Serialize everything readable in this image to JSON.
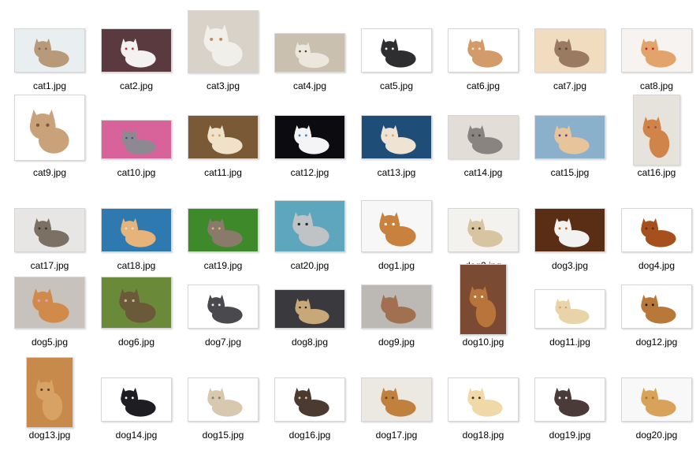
{
  "files": [
    {
      "name": "cat1.jpg",
      "shape": "wide",
      "bg": "#e9eef0",
      "subject": "#b89a7a",
      "accent": "#8a6a4e"
    },
    {
      "name": "cat2.jpg",
      "shape": "wide",
      "bg": "#5a3a3e",
      "subject": "#f4f2f0",
      "accent": "#c8283a"
    },
    {
      "name": "cat3.jpg",
      "shape": "tall4",
      "bg": "#d9d2c8",
      "subject": "#f1efe9",
      "accent": "#c88a54"
    },
    {
      "name": "cat4.jpg",
      "shape": "wide2",
      "bg": "#c9c0b0",
      "subject": "#ece7dc",
      "accent": "#4a3c2a"
    },
    {
      "name": "cat5.jpg",
      "shape": "wide",
      "bg": "#ffffff",
      "subject": "#2e2e30",
      "accent": "#f0f0f0"
    },
    {
      "name": "cat6.jpg",
      "shape": "wide",
      "bg": "#ffffff",
      "subject": "#d39a6a",
      "accent": "#f2e2d0"
    },
    {
      "name": "cat7.jpg",
      "shape": "wide",
      "bg": "#f1dcbf",
      "subject": "#9a7a60",
      "accent": "#5e4634"
    },
    {
      "name": "cat8.jpg",
      "shape": "wide",
      "bg": "#f6f3f0",
      "subject": "#e2a46a",
      "accent": "#c8202e"
    },
    {
      "name": "cat9.jpg",
      "shape": "tall",
      "bg": "#ffffff",
      "subject": "#c9a27a",
      "accent": "#7a5a3e"
    },
    {
      "name": "cat10.jpg",
      "shape": "wide2",
      "bg": "#d8629a",
      "subject": "#8c8a90",
      "accent": "#3e4e8a"
    },
    {
      "name": "cat11.jpg",
      "shape": "wide",
      "bg": "#7a5a36",
      "subject": "#f0e2c8",
      "accent": "#d2a064"
    },
    {
      "name": "cat12.jpg",
      "shape": "wide",
      "bg": "#0c0c10",
      "subject": "#f4f4f6",
      "accent": "#3a8ad0"
    },
    {
      "name": "cat13.jpg",
      "shape": "wide",
      "bg": "#1e4e78",
      "subject": "#efe4d4",
      "accent": "#d2a676"
    },
    {
      "name": "cat14.jpg",
      "shape": "wide",
      "bg": "#e2ddd6",
      "subject": "#8a8480",
      "accent": "#4a4440"
    },
    {
      "name": "cat15.jpg",
      "shape": "wide",
      "bg": "#8ab0cc",
      "subject": "#e8c49a",
      "accent": "#6a3aa0"
    },
    {
      "name": "cat16.jpg",
      "shape": "portrait",
      "bg": "#e6e2dc",
      "subject": "#d0844a",
      "accent": "#a45a2a"
    },
    {
      "name": "cat17.jpg",
      "shape": "wide",
      "bg": "#e8e6e4",
      "subject": "#7a7064",
      "accent": "#3a3430"
    },
    {
      "name": "cat18.jpg",
      "shape": "wide",
      "bg": "#2e7ab0",
      "subject": "#e6b47a",
      "accent": "#cfe0ea"
    },
    {
      "name": "cat19.jpg",
      "shape": "wide",
      "bg": "#3e8a2a",
      "subject": "#8a7a6a",
      "accent": "#d6b488"
    },
    {
      "name": "cat20.jpg",
      "shape": "tall3",
      "bg": "#5ea6be",
      "subject": "#bfc3c6",
      "accent": "#2a2a2a"
    },
    {
      "name": "dog1.jpg",
      "shape": "tall3",
      "bg": "#f7f7f7",
      "subject": "#c9823e",
      "accent": "#ffffff"
    },
    {
      "name": "dog2.jpg",
      "shape": "wide",
      "bg": "#f4f2ef",
      "subject": "#d8c4a0",
      "accent": "#3a2e26"
    },
    {
      "name": "dog3.jpg",
      "shape": "wide",
      "bg": "#5a2e14",
      "subject": "#f2f2f0",
      "accent": "#c86a24"
    },
    {
      "name": "dog4.jpg",
      "shape": "wide",
      "bg": "#ffffff",
      "subject": "#a6501e",
      "accent": "#6a2a10"
    },
    {
      "name": "dog5.jpg",
      "shape": "tall3",
      "bg": "#c8c2bc",
      "subject": "#d08a4a",
      "accent": "#e8a0a8"
    },
    {
      "name": "dog6.jpg",
      "shape": "tall3",
      "bg": "#6a8a3a",
      "subject": "#6a5a3a",
      "accent": "#c8b88a"
    },
    {
      "name": "dog7.jpg",
      "shape": "wide",
      "bg": "#ffffff",
      "subject": "#4a4a4e",
      "accent": "#f0f0f0"
    },
    {
      "name": "dog8.jpg",
      "shape": "wide2",
      "bg": "#3a3a3e",
      "subject": "#c8a878",
      "accent": "#2a2420"
    },
    {
      "name": "dog9.jpg",
      "shape": "wide",
      "bg": "#bcb8b4",
      "subject": "#a07050",
      "accent": "#e24a7a"
    },
    {
      "name": "dog10.jpg",
      "shape": "portrait",
      "bg": "#7a4a32",
      "subject": "#b8743a",
      "accent": "#ffffff"
    },
    {
      "name": "dog11.jpg",
      "shape": "wide2",
      "bg": "#ffffff",
      "subject": "#e8d4a8",
      "accent": "#c8a670"
    },
    {
      "name": "dog12.jpg",
      "shape": "wide",
      "bg": "#ffffff",
      "subject": "#b8783a",
      "accent": "#1e1e22"
    },
    {
      "name": "dog13.jpg",
      "shape": "portrait",
      "bg": "#c88a4a",
      "subject": "#d8a264",
      "accent": "#5a3a22"
    },
    {
      "name": "dog14.jpg",
      "shape": "wide",
      "bg": "#ffffff",
      "subject": "#1e1e22",
      "accent": "#f4f4f4"
    },
    {
      "name": "dog15.jpg",
      "shape": "wide",
      "bg": "#ffffff",
      "subject": "#d8c8b0",
      "accent": "#8a7a6a"
    },
    {
      "name": "dog16.jpg",
      "shape": "wide",
      "bg": "#ffffff",
      "subject": "#4a3a30",
      "accent": "#d8c0a0"
    },
    {
      "name": "dog17.jpg",
      "shape": "wide",
      "bg": "#ece8e2",
      "subject": "#c0803e",
      "accent": "#6a4020"
    },
    {
      "name": "dog18.jpg",
      "shape": "wide",
      "bg": "#ffffff",
      "subject": "#f0d8a8",
      "accent": "#3a2a22"
    },
    {
      "name": "dog19.jpg",
      "shape": "wide",
      "bg": "#ffffff",
      "subject": "#4a3a38",
      "accent": "#f0f0f0"
    },
    {
      "name": "dog20.jpg",
      "shape": "wide",
      "bg": "#f8f8f8",
      "subject": "#d8a25a",
      "accent": "#a8702e"
    }
  ]
}
